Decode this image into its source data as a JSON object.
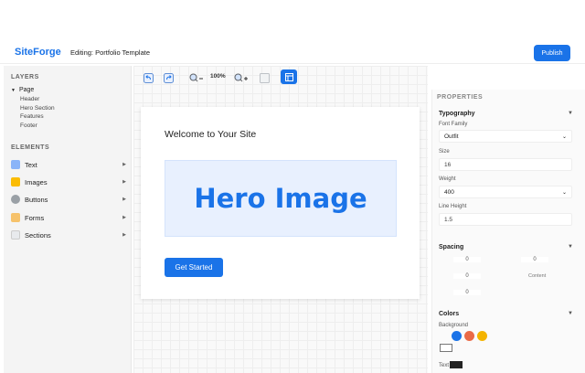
{
  "header": {
    "logo": "SiteForge",
    "editing": "Editing: Portfolio Template",
    "publish_label": "Publish"
  },
  "layers": {
    "title": "LAYERS",
    "root": "Page",
    "children": [
      "Header",
      "Hero Section",
      "Features",
      "Footer"
    ]
  },
  "elements": {
    "title": "ELEMENTS",
    "items": [
      {
        "label": "Text",
        "icon": "text-icon"
      },
      {
        "label": "Images",
        "icon": "image-icon"
      },
      {
        "label": "Buttons",
        "icon": "button-icon"
      },
      {
        "label": "Forms",
        "icon": "form-icon"
      },
      {
        "label": "Sections",
        "icon": "section-icon"
      }
    ]
  },
  "toolbar": {
    "undo_icon": "undo-icon",
    "redo_icon": "redo-icon",
    "zoom_out_icon": "zoom-out-icon",
    "zoom": "100%",
    "zoom_in_icon": "zoom-in-icon",
    "frame_icon": "frame-icon",
    "grid_icon": "grid-icon"
  },
  "canvas": {
    "welcome": "Welcome to Your Site",
    "hero_text": "Hero Image",
    "cta_label": "Get Started"
  },
  "properties": {
    "title": "PROPERTIES",
    "typography": {
      "title": "Typography",
      "font_family_label": "Font Family",
      "font_family_value": "Outfit",
      "size_label": "Size",
      "size_value": "16",
      "weight_label": "Weight",
      "weight_value": "400",
      "line_height_label": "Line Height",
      "line_height_value": "1.5"
    },
    "spacing": {
      "title": "Spacing",
      "top": "0",
      "right": "0",
      "left": "0",
      "bottom": "0",
      "content_label": "Content"
    },
    "colors": {
      "title": "Colors",
      "background_label": "Background",
      "text_label": "Text",
      "swatches": [
        "#1a73e8",
        "#ea6a47",
        "#f4b400"
      ],
      "text_color": "#222222"
    }
  },
  "colors": {
    "accent": "#1a73e8"
  }
}
